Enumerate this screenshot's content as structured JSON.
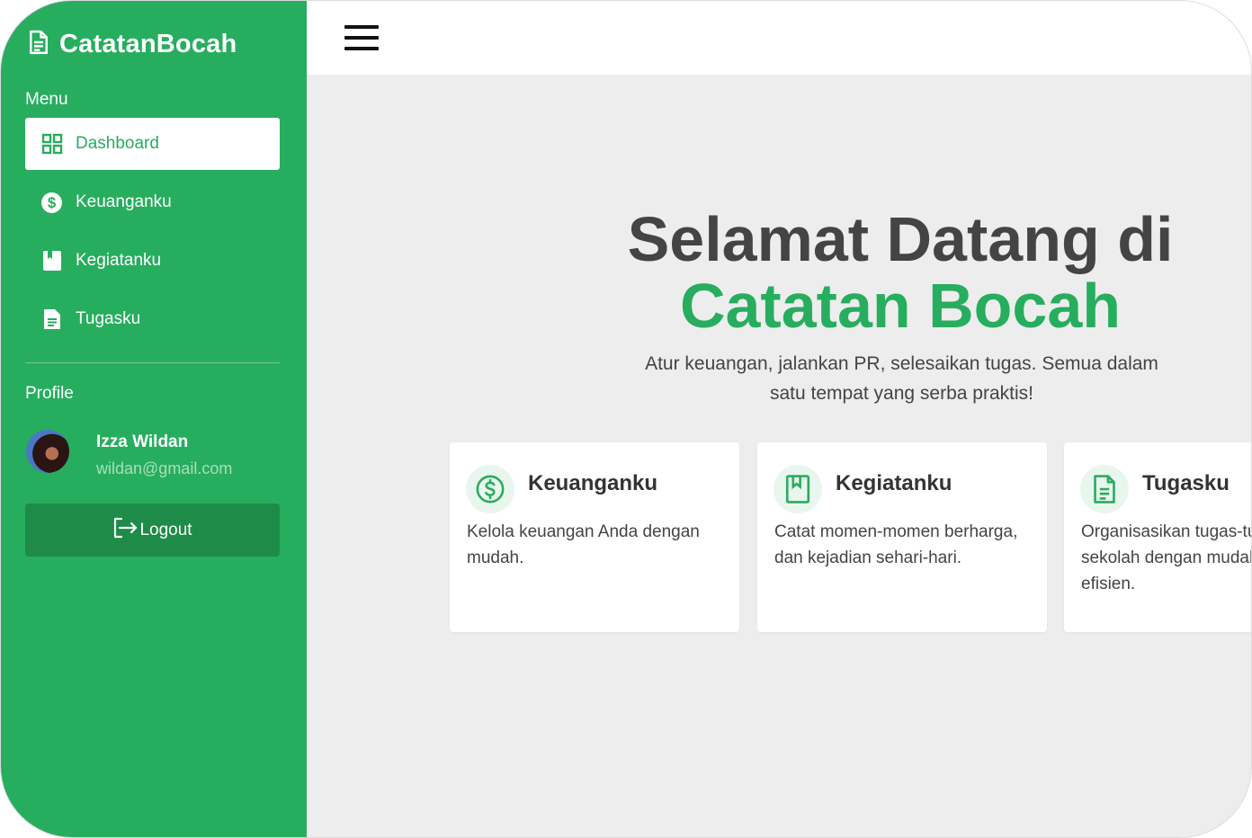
{
  "app": {
    "brand": "CatatanBocah"
  },
  "sidebar": {
    "menu_label": "Menu",
    "items": [
      {
        "label": "Dashboard",
        "icon": "grid-icon",
        "active": true
      },
      {
        "label": "Keuanganku",
        "icon": "dollar-circle-icon",
        "active": false
      },
      {
        "label": "Kegiatanku",
        "icon": "bookmark-book-icon",
        "active": false
      },
      {
        "label": "Tugasku",
        "icon": "document-icon",
        "active": false
      }
    ],
    "profile_label": "Profile",
    "user": {
      "name": "Izza Wildan",
      "email": "wildan@gmail.com"
    },
    "logout_label": "Logout"
  },
  "hero": {
    "title_line1": "Selamat Datang di",
    "title_line2": "Catatan Bocah",
    "subtitle": "Atur keuangan, jalankan PR, selesaikan tugas. Semua dalam satu tempat yang serba praktis!"
  },
  "cards": [
    {
      "title": "Keuanganku",
      "desc": "Kelola keuangan Anda dengan mudah.",
      "icon": "dollar-circle-icon"
    },
    {
      "title": "Kegiatanku",
      "desc": "Catat momen-momen berharga, dan kejadian sehari-hari.",
      "icon": "bookmark-book-icon"
    },
    {
      "title": "Tugasku",
      "desc": "Organisasikan tugas-tugas sekolah dengan mudah dan efisien.",
      "icon": "document-icon"
    }
  ],
  "colors": {
    "accent": "#27ad5e",
    "logout": "#1e8b48",
    "background": "#ededed",
    "heading": "#444444"
  }
}
